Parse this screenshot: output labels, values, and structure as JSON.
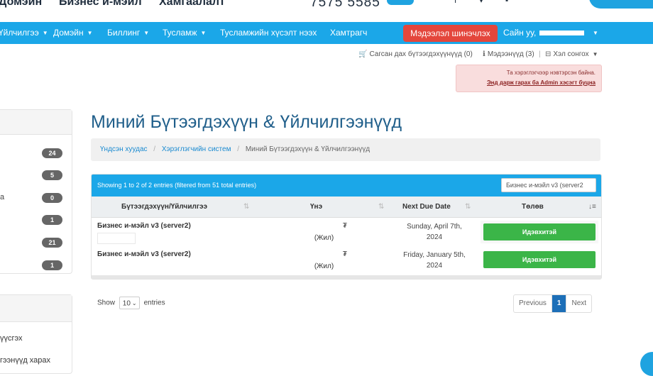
{
  "top_header": {
    "links": [
      "Домэйн",
      "Бизнес и-мэйл",
      "Хамгаалалт"
    ],
    "phone": "7575 5585"
  },
  "nav": {
    "items": [
      "Үйлчилгээ",
      "Домэйн",
      "Биллинг",
      "Тусламж",
      "Тусламжийн хүсэлт нээх",
      "Хамтрагч"
    ],
    "alert_button": "Мэдээлэл шинэчлэх",
    "user_label": "Сайн уу,"
  },
  "subtoolbar": {
    "cart": "Сагсан дах бүтээгдэхүүнүүд (0)",
    "notifications": "Мэдээнүүд (3)",
    "language": "Хэл сонгох"
  },
  "admin_notice": {
    "line1": "Та хэрэглэгчээр нэвтэрсэн байна.",
    "line2": "Энд дарж гарах ба Admin хэсэгт буцна"
  },
  "sidebar": {
    "counts": [
      {
        "label": "",
        "count": "24"
      },
      {
        "label": "",
        "count": "5"
      },
      {
        "label": "а",
        "count": "0"
      },
      {
        "label": "",
        "count": "1"
      },
      {
        "label": "",
        "count": "21"
      },
      {
        "label": "",
        "count": "1"
      }
    ],
    "links": [
      "үүсгэх",
      "гээнүүд харах"
    ]
  },
  "page": {
    "title": "Миний Бүтээгдэхүүн & Үйлчилгээнүүд",
    "breadcrumb": [
      "Үндсэн хуудас",
      "Хэрэглэгчийн систем",
      "Миний Бүтээгдэхүүн & Үйлчилгээнүүд"
    ]
  },
  "table": {
    "info": "Showing 1 to 2 of 2 entries (filtered from 51 total entries)",
    "filter_value": "Бизнес и-мэйл v3 (server2",
    "columns": [
      "Бүтээгдэхүүн/Үйлчилгээ",
      "Үнэ",
      "Next Due Date",
      "Төлөв"
    ],
    "rows": [
      {
        "name": "Бизнес и-мэйл v3 (server2)",
        "currency": "₮",
        "cycle": "(Жил)",
        "date_line1": "Sunday, April 7th,",
        "date_line2": "2024",
        "status": "Идэвхитэй"
      },
      {
        "name": "Бизнес и-мэйл v3 (server2)",
        "currency": "₮",
        "cycle": "(Жил)",
        "date_line1": "Friday, January 5th,",
        "date_line2": "2024",
        "status": "Идэвхитэй"
      }
    ],
    "length_prefix": "Show",
    "length_value": "10",
    "length_suffix": "entries",
    "pager": {
      "previous": "Previous",
      "current": "1",
      "next": "Next"
    }
  },
  "colors": {
    "primary": "#1ba7e8",
    "danger": "#e4463c",
    "success": "#3bb548",
    "title": "#1f5e8a"
  }
}
